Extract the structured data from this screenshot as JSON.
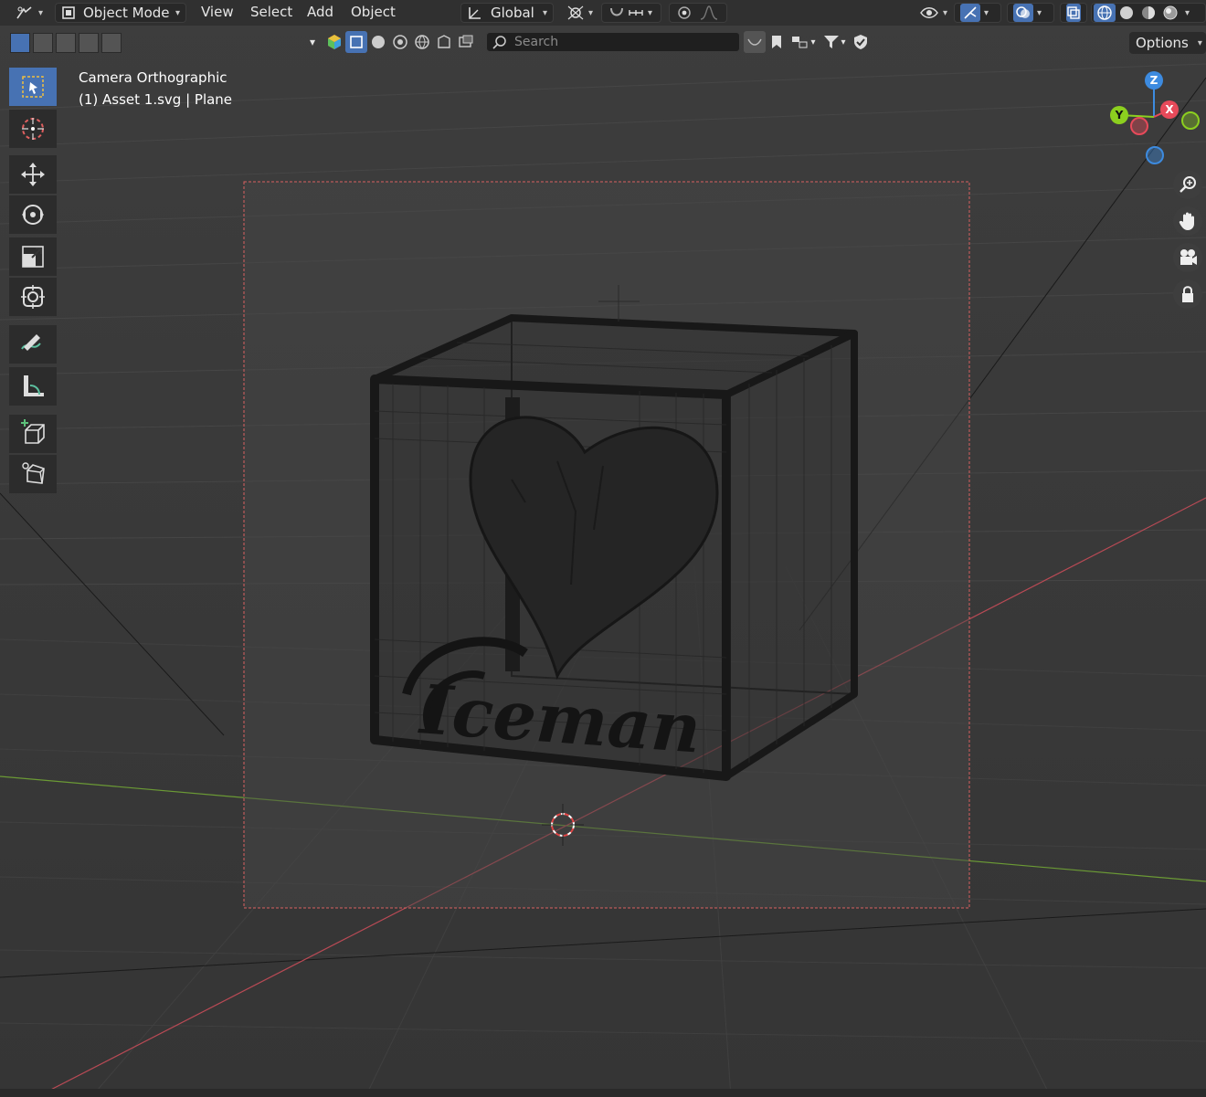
{
  "header": {
    "mode_label": "Object Mode",
    "menus": [
      "View",
      "Select",
      "Add",
      "Object"
    ],
    "transform_orientation": "Global"
  },
  "toolbar_row": {
    "search_placeholder": "Search",
    "options_label": "Options"
  },
  "viewport": {
    "camera_label": "Camera Orthographic",
    "object_label": "(1) Asset 1.svg | Plane",
    "model_text": "Iceman",
    "gizmo": {
      "z": "Z",
      "y": "Y",
      "x": "X"
    }
  },
  "colors": {
    "accent": "#4772b3",
    "axis_x": "#e74a5a",
    "axis_y": "#8ccf1f",
    "axis_z": "#3d8be0",
    "camera_frame": "#d96060",
    "grid_x_line": "#b94a55",
    "grid_y_line": "#6b9a35"
  },
  "icons": {
    "editor_type": "editor-type-icon",
    "mode": "object-mode-icon",
    "orientation": "transform-orientation-icon",
    "pivot": "pivot-point-icon",
    "snap": "snap-magnet-icon",
    "proportional": "proportional-editing-icon",
    "visibility": "visibility-eye-icon",
    "gizmo_toggle": "gizmo-toggle-icon",
    "overlays": "overlays-icon",
    "xray": "xray-icon",
    "shading": [
      "wireframe-shading-icon",
      "solid-shading-icon",
      "material-shading-icon",
      "rendered-shading-icon"
    ],
    "tools": [
      "select-box-icon",
      "cursor-icon",
      "move-icon",
      "rotate-icon",
      "scale-icon",
      "transform-icon",
      "annotate-icon",
      "measure-icon",
      "add-cube-icon",
      "add-primitive-icon"
    ],
    "nav": [
      "zoom-icon",
      "pan-hand-icon",
      "camera-view-icon",
      "lock-camera-icon"
    ]
  }
}
